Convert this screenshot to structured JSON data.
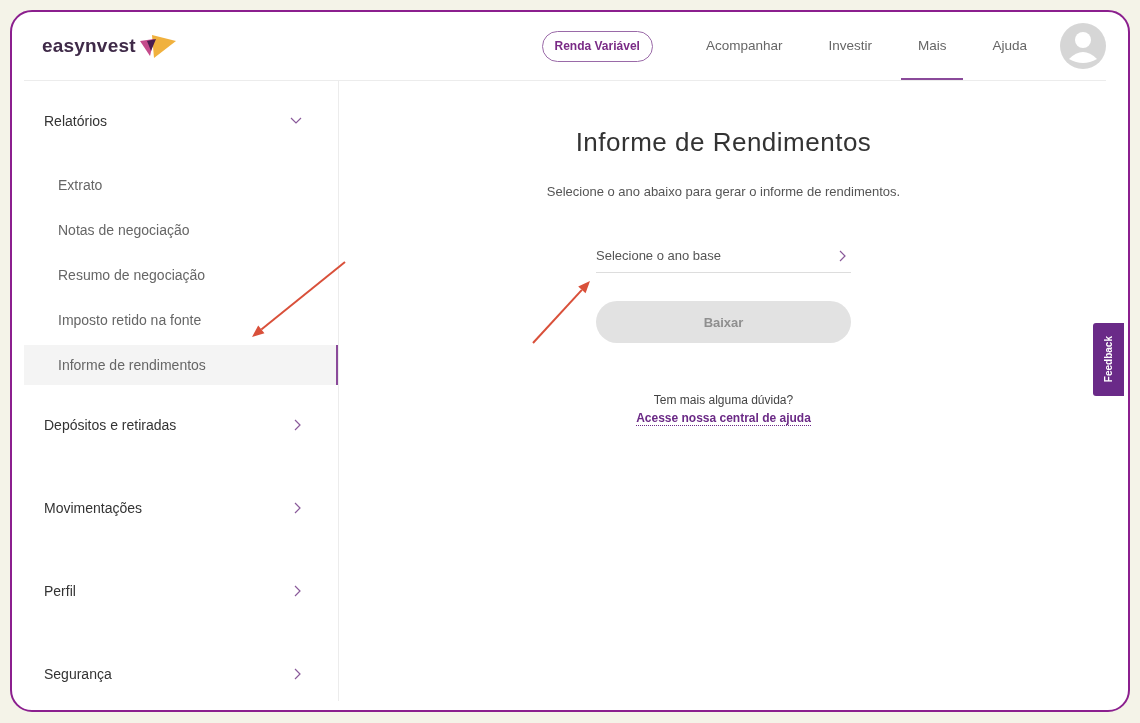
{
  "logo": {
    "text": "easynvest"
  },
  "nav": {
    "cta": "Renda Variável",
    "tabs": [
      {
        "label": "Acompanhar",
        "selected": false
      },
      {
        "label": "Investir",
        "selected": false
      },
      {
        "label": "Mais",
        "selected": true
      },
      {
        "label": "Ajuda",
        "selected": false
      }
    ]
  },
  "sidebar": {
    "items": [
      {
        "label": "Relatórios",
        "expanded": true,
        "children": [
          {
            "label": "Extrato",
            "selected": false
          },
          {
            "label": "Notas de negociação",
            "selected": false
          },
          {
            "label": "Resumo de negociação",
            "selected": false
          },
          {
            "label": "Imposto retido na fonte",
            "selected": false
          },
          {
            "label": "Informe de rendimentos",
            "selected": true
          }
        ]
      },
      {
        "label": "Depósitos e retiradas",
        "expanded": false
      },
      {
        "label": "Movimentações",
        "expanded": false
      },
      {
        "label": "Perfil",
        "expanded": false
      },
      {
        "label": "Segurança",
        "expanded": false
      }
    ]
  },
  "main": {
    "title": "Informe de Rendimentos",
    "subtitle": "Selecione o ano abaixo para gerar o informe de rendimentos.",
    "year_select": {
      "placeholder": "Selecione o ano base"
    },
    "download_button": {
      "label": "Baixar",
      "disabled": true
    },
    "help_text": "Tem mais alguma dúvida?",
    "help_link": "Acesse nossa central de ajuda"
  },
  "feedback_tab": "Feedback",
  "annotations": [
    {
      "kind": "arrow"
    },
    {
      "kind": "arrow"
    }
  ]
}
